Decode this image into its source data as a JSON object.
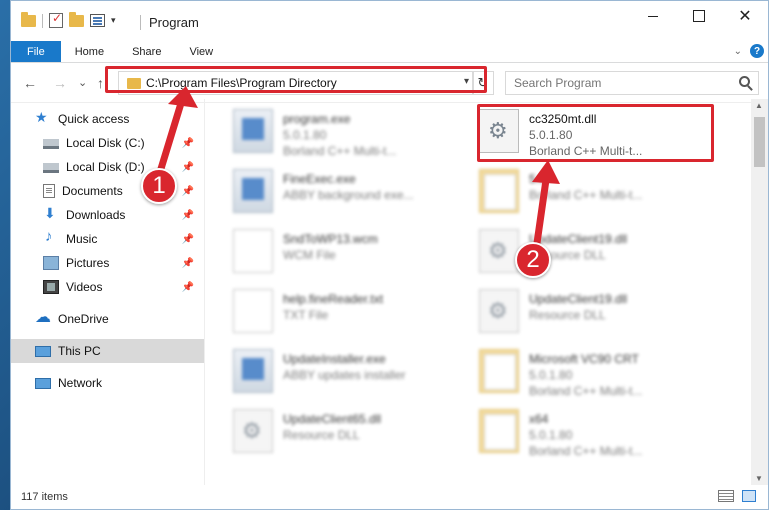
{
  "window": {
    "title": "Program",
    "controls": {
      "minimize": "",
      "maximize": "",
      "close": "✕"
    }
  },
  "ribbon": {
    "tabs": [
      "File",
      "Home",
      "Share",
      "View"
    ],
    "help": "?"
  },
  "navigation": {
    "back": "←",
    "forward": "→",
    "recent": "⌄",
    "up": "↑",
    "address": "C:\\Program Files\\Program Directory",
    "refresh": "↻",
    "search_placeholder": "Search Program"
  },
  "sidebar": {
    "quick_access": "Quick access",
    "items": [
      {
        "label": "Local Disk (C:)",
        "icon": "disk-icon"
      },
      {
        "label": "Local Disk (D:)",
        "icon": "disk-icon"
      },
      {
        "label": "Documents",
        "icon": "documents-icon"
      },
      {
        "label": "Downloads",
        "icon": "downloads-icon"
      },
      {
        "label": "Music",
        "icon": "music-icon"
      },
      {
        "label": "Pictures",
        "icon": "pictures-icon"
      },
      {
        "label": "Videos",
        "icon": "videos-icon"
      }
    ],
    "onedrive": "OneDrive",
    "this_pc": "This PC",
    "network": "Network"
  },
  "files": [
    {
      "name": "program.exe",
      "line1": "5.0.1.80",
      "line2": "Borland C++ Multi-t...",
      "icon": "exe",
      "blurred": true
    },
    {
      "name": "cc3250mt.dll",
      "line1": "5.0.1.80",
      "line2": "Borland C++ Multi-t...",
      "icon": "dll",
      "blurred": false
    },
    {
      "name": "FineExec.exe",
      "line1": "ABBY background exe...",
      "line2": "",
      "icon": "exe",
      "blurred": true
    },
    {
      "name": "5.0",
      "line1": "Borland C++ Multi-t...",
      "line2": "",
      "icon": "folder",
      "blurred": true
    },
    {
      "name": "SndToWP13.wcm",
      "line1": "WCM File",
      "line2": "",
      "icon": "doc",
      "blurred": true
    },
    {
      "name": "UpdateClient19.dll",
      "line1": "Resource DLL",
      "line2": "",
      "icon": "dll",
      "blurred": true
    },
    {
      "name": "help.fineReader.txt",
      "line1": "TXT File",
      "line2": "",
      "icon": "doc",
      "blurred": true
    },
    {
      "name": "UpdateClient19.dll",
      "line1": "Resource DLL",
      "line2": "",
      "icon": "dll",
      "blurred": true
    },
    {
      "name": "UpdateInstaller.exe",
      "line1": "ABBY updates installer",
      "line2": "",
      "icon": "exe",
      "blurred": true
    },
    {
      "name": "Microsoft VC90 CRT",
      "line1": "5.0.1.80",
      "line2": "Borland C++ Multi-t...",
      "icon": "folder",
      "blurred": true
    },
    {
      "name": "UpdateClient65.dll",
      "line1": "Resource DLL",
      "line2": "",
      "icon": "dll",
      "blurred": true
    },
    {
      "name": "x64",
      "line1": "5.0.1.80",
      "line2": "Borland C++ Multi-t...",
      "icon": "folder",
      "blurred": true
    }
  ],
  "status": {
    "items": "117 items"
  },
  "annotations": {
    "step1": "1",
    "step2": "2",
    "color": "#d9262e"
  }
}
